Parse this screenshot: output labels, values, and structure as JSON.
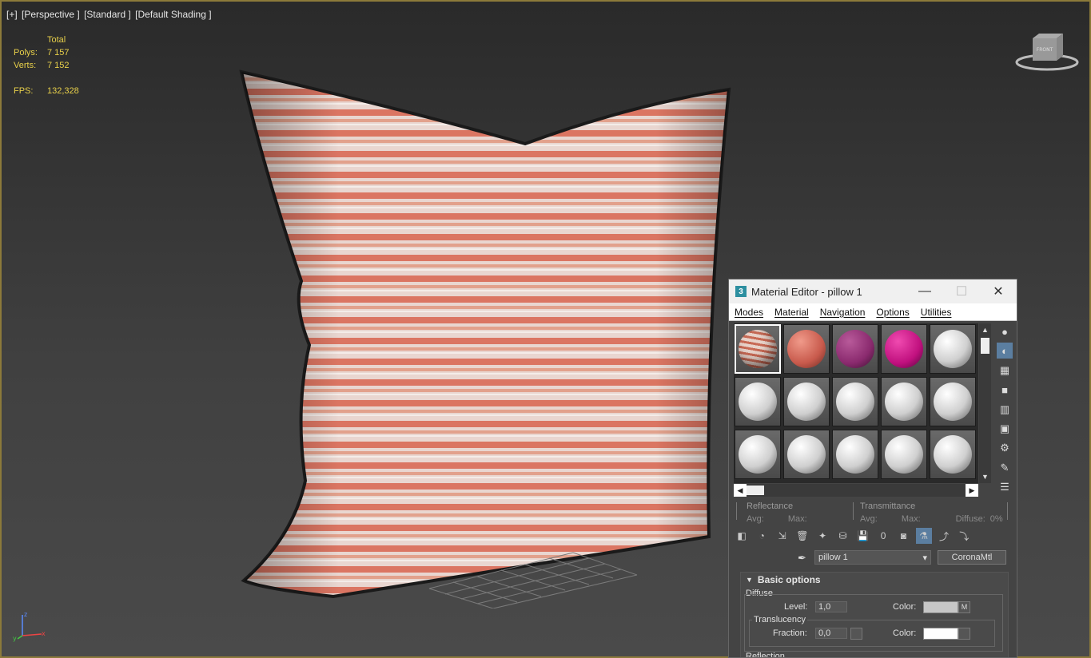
{
  "viewport": {
    "labels": [
      "[+]",
      "[Perspective ]",
      "[Standard ]",
      "[Default Shading ]"
    ],
    "stats": {
      "header": "Total",
      "polys_label": "Polys:",
      "polys": "7 157",
      "verts_label": "Verts:",
      "verts": "7 152",
      "fps_label": "FPS:",
      "fps": "132,328"
    },
    "viewcube_label": "FRONT"
  },
  "material_editor": {
    "title": "Material Editor - pillow 1",
    "window_buttons": {
      "minimize": "—",
      "maximize": "☐",
      "close": "✕"
    },
    "menu": [
      "Modes",
      "Material",
      "Navigation",
      "Options",
      "Utilities"
    ],
    "slots": [
      [
        "pillow-texture",
        "coral",
        "purple",
        "magenta",
        "white"
      ],
      [
        "white",
        "white",
        "white",
        "white",
        "white"
      ],
      [
        "white",
        "white",
        "white",
        "white",
        "white"
      ]
    ],
    "reflectance": {
      "title": "Reflectance",
      "avg": "Avg:",
      "max": "Max:"
    },
    "transmittance": {
      "title": "Transmittance",
      "avg": "Avg:",
      "max": "Max:",
      "diffuse": "Diffuse:",
      "diffuse_value": "0%"
    },
    "material_name": "pillow 1",
    "material_type": "CoronaMtl",
    "basic_options": {
      "title": "Basic options",
      "diffuse_label": "Diffuse",
      "level_label": "Level:",
      "level_value": "1,0",
      "color_label": "Color:",
      "m_label": "M",
      "translucency_label": "Translucency",
      "fraction_label": "Fraction:",
      "fraction_value": "0,0",
      "color2_label": "Color:",
      "reflection_label": "Reflection"
    }
  },
  "colors": {
    "viewport_border": "#8c7a3a",
    "stats_text": "#e8d04a",
    "diffuse_swatch": "#c6c6c6",
    "translucency_swatch": "#ffffff"
  }
}
